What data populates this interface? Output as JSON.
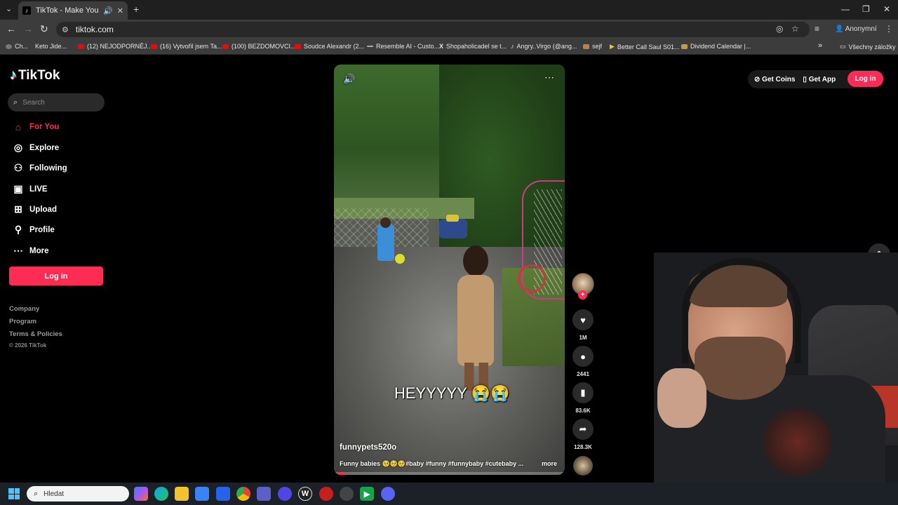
{
  "browser": {
    "tab_title": "TikTok - Make Your Day",
    "url": "tiktok.com",
    "profile": "Anonymní",
    "bookmarks": [
      "Ch...",
      "Keto Jide...",
      "(12) NEJODPORNĚJ...",
      "(16) Vytvořil jsem Ta...",
      "(100) BEZDOMOVCI...",
      "Soudce Alexandr (2...",
      "Resemble AI - Custo...",
      "Shopaholicadel se t...",
      "Angry..Virgo (@ang...",
      "sejf",
      "Better Call Saul S01...",
      "Dividend Calendar |..."
    ],
    "all_bookmarks": "Všechny záložky"
  },
  "sidebar": {
    "logo": "TikTok",
    "search_placeholder": "Search",
    "menu": [
      {
        "label": "For You",
        "icon": "home-icon"
      },
      {
        "label": "Explore",
        "icon": "compass-icon"
      },
      {
        "label": "Following",
        "icon": "following-icon"
      },
      {
        "label": "LIVE",
        "icon": "live-icon"
      },
      {
        "label": "Upload",
        "icon": "upload-icon"
      },
      {
        "label": "Profile",
        "icon": "profile-icon"
      },
      {
        "label": "More",
        "icon": "more-icon"
      }
    ],
    "login": "Log in",
    "footer": [
      "Company",
      "Program",
      "Terms & Policies"
    ],
    "copyright": "© 2026 TikTok"
  },
  "topright": {
    "coins": "Get Coins",
    "app": "Get App",
    "login": "Log in"
  },
  "video": {
    "overlay_text": "HEYYYYY 😭😭",
    "author": "funnypets520o",
    "description": "Funny babies 🥺🥺🥺#baby #funny #funnybaby #cutebaby ...",
    "more": "more",
    "progress": 0.05
  },
  "actions": {
    "likes": "1M",
    "comments": "2441",
    "saves": "83.6K",
    "shares": "128.3K"
  },
  "taskbar": {
    "search_placeholder": "Hledat"
  },
  "colors": {
    "accent": "#fe2c55",
    "background": "#000000",
    "chrome": "#3c3c3c"
  }
}
